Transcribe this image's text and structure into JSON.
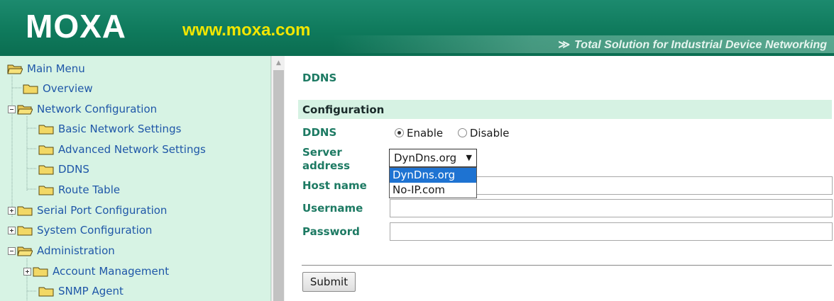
{
  "header": {
    "logo": "MOXA",
    "url": "www.moxa.com",
    "tagline_chevron": "≫",
    "tagline": "Total Solution for Industrial Device Networking"
  },
  "sidebar": {
    "items": [
      {
        "label": "Main Menu",
        "icon": "folder-open-icon"
      },
      {
        "label": "Overview",
        "icon": "folder-icon"
      },
      {
        "label": "Network Configuration",
        "icon": "folder-open-icon",
        "expander": "minus"
      },
      {
        "label": "Basic Network Settings",
        "icon": "folder-icon"
      },
      {
        "label": "Advanced Network Settings",
        "icon": "folder-icon"
      },
      {
        "label": "DDNS",
        "icon": "folder-icon"
      },
      {
        "label": "Route Table",
        "icon": "folder-icon"
      },
      {
        "label": "Serial Port Configuration",
        "icon": "folder-icon",
        "expander": "plus"
      },
      {
        "label": "System Configuration",
        "icon": "folder-icon",
        "expander": "plus"
      },
      {
        "label": "Administration",
        "icon": "folder-open-icon",
        "expander": "minus"
      },
      {
        "label": "Account Management",
        "icon": "folder-icon",
        "expander": "plus"
      },
      {
        "label": "SNMP Agent",
        "icon": "folder-icon"
      }
    ]
  },
  "main": {
    "title": "DDNS",
    "section": "Configuration",
    "ddns": {
      "label": "DDNS",
      "enable_label": "Enable",
      "disable_label": "Disable",
      "selected": "Enable"
    },
    "server": {
      "label_line1": "Server",
      "label_line2": "address",
      "selected": "DynDns.org",
      "arrow": "▼",
      "options": [
        "DynDns.org",
        "No-IP.com"
      ]
    },
    "host_name": {
      "label": "Host name",
      "value": ""
    },
    "username": {
      "label": "Username",
      "value": ""
    },
    "password": {
      "label": "Password",
      "value": ""
    },
    "submit_label": "Submit"
  },
  "colors": {
    "header_green": "#0f7a5c",
    "logo_url_yellow": "#f2e600",
    "sidebar_bg": "#d7f3e4",
    "label_green": "#1d7a63",
    "link_blue": "#1f57a8",
    "dropdown_highlight": "#1e73d2"
  }
}
